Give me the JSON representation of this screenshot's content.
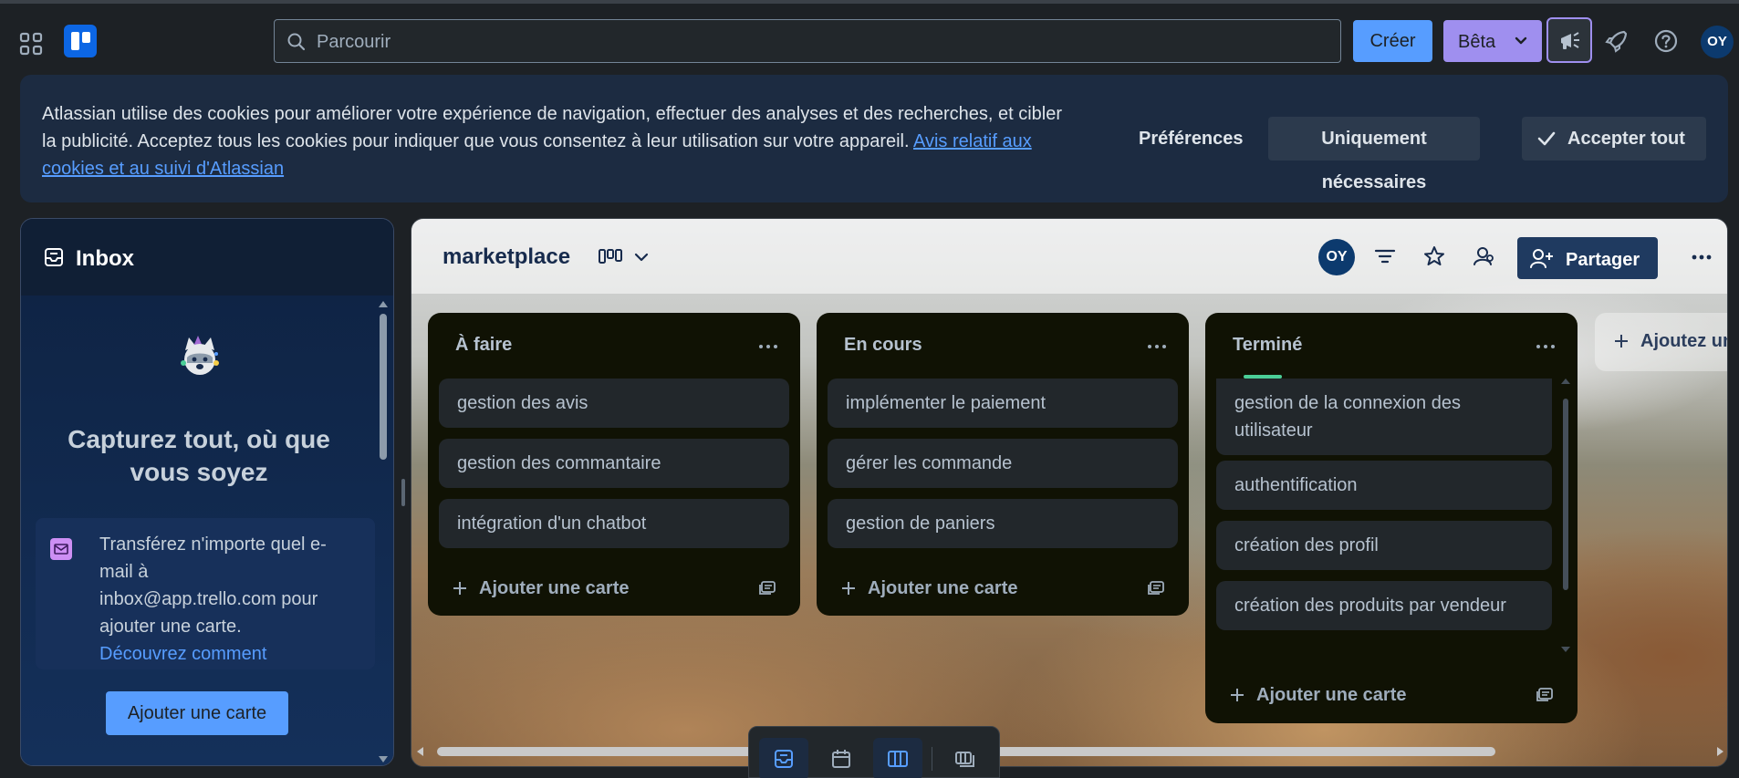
{
  "topbar": {
    "search_placeholder": "Parcourir",
    "create_label": "Créer",
    "beta_label": "Bêta",
    "avatar_initials": "OY",
    "icons": [
      "app-switcher-icon",
      "trello-logo",
      "search-icon",
      "chevron-down-icon",
      "megaphone-icon",
      "rocket-icon",
      "help-icon"
    ]
  },
  "cookie_banner": {
    "text": "Atlassian utilise des cookies pour améliorer votre expérience de navigation, effectuer des analyses et des recherches, et cibler la publicité. Acceptez tous les cookies pour indiquer que vous consentez à leur utilisation sur votre appareil.",
    "link_text": "Avis relatif aux cookies et au suivi d'Atlassian",
    "preferences_label": "Préférences",
    "necessary_label": "Uniquement nécessaires",
    "accept_label": "Accepter tout"
  },
  "inbox": {
    "title": "Inbox",
    "heading": "Capturez tout, où que vous soyez",
    "tip_text": "Transférez n'importe quel e-mail à inbox@app.trello.com pour ajouter une carte.",
    "tip_link": "Découvrez comment",
    "add_card_label": "Ajouter une carte"
  },
  "board": {
    "title": "marketplace",
    "avatar_initials": "OY",
    "share_label": "Partager",
    "add_list_label": "Ajoutez une autre liste",
    "lists": [
      {
        "title": "À faire",
        "cards": [
          "gestion des avis",
          "gestion des commantaire",
          "intégration d'un chatbot"
        ],
        "add_card_label": "Ajouter une carte"
      },
      {
        "title": "En cours",
        "cards": [
          "implémenter le paiement",
          "gérer les commande",
          "gestion de paniers"
        ],
        "add_card_label": "Ajouter une carte"
      },
      {
        "title": "Terminé",
        "cards": [
          "gestion de la connexion des utilisateur",
          "authentification",
          "création des profil",
          "création des produits par vendeur"
        ],
        "add_card_label": "Ajouter une carte"
      }
    ]
  },
  "view_switcher": {
    "items": [
      "inbox-view-icon",
      "planner-icon",
      "board-view-icon",
      "switch-boards-icon"
    ],
    "active": "board-view-icon"
  },
  "colors": {
    "accent_blue": "#579dff",
    "beta_purple": "#9f8fef",
    "list_background": "#101204",
    "card_background": "#22272b",
    "label_green": "#4bce97"
  }
}
